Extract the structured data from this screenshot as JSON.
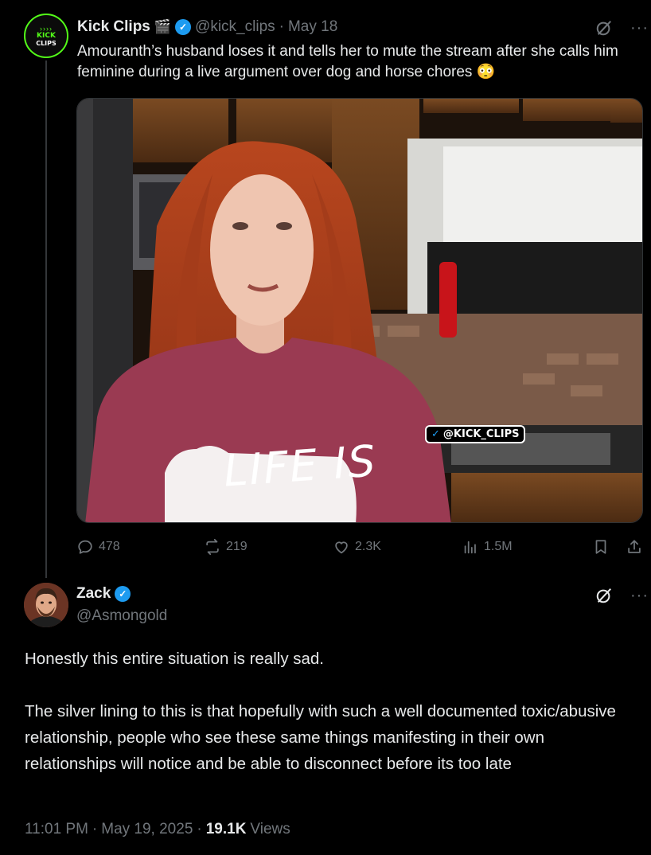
{
  "tweet": {
    "author_name": "Kick Clips",
    "author_name_emoji": "🎬",
    "avatar_text": "KICK",
    "avatar_text2": "CLIPS",
    "handle": "@kick_clips",
    "separator": "·",
    "date": "May 18",
    "text": "Amouranth’s husband loses it and tells her to mute the stream after she calls him feminine during a live argument over dog and horse chores 😳",
    "media": {
      "watermark": "@KICK_CLIPS",
      "shirt_text": "LIFE IS"
    },
    "stats": {
      "replies": "478",
      "reposts": "219",
      "likes": "2.3K",
      "views": "1.5M"
    }
  },
  "reply": {
    "author_name": "Zack",
    "handle": "@Asmongold",
    "paragraph1": "Honestly this entire situation is really sad.",
    "paragraph2": "The silver lining to this is that hopefully with such a well documented toxic/abusive relationship, people who see these same things manifesting in their own relationships will notice and be able to disconnect before its too late",
    "time": "11:01 PM",
    "separator": "·",
    "date": "May 19, 2025",
    "separator2": "·",
    "views_count": "19.1K",
    "views_label": "Views"
  },
  "icons": {
    "verified": "verified-badge-icon",
    "grok": "grok-icon",
    "more": "more-dots-icon",
    "reply": "reply-icon",
    "repost": "repost-icon",
    "like": "heart-icon",
    "views": "views-chart-icon",
    "bookmark": "bookmark-icon",
    "share": "share-icon"
  },
  "colors": {
    "background": "#000000",
    "text": "#e7e9ea",
    "muted": "#71767b",
    "verified": "#1d9bf0",
    "kick_green": "#53fc18"
  }
}
